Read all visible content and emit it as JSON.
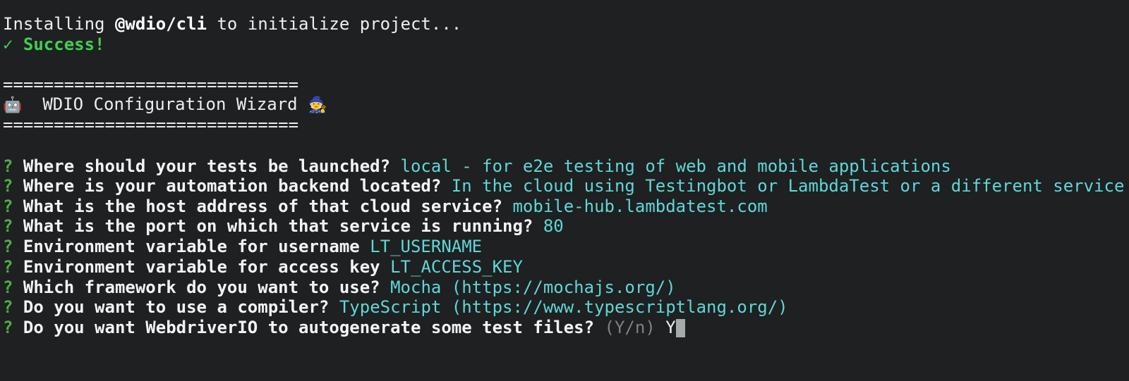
{
  "terminal": {
    "background_color": "#1e2021",
    "foreground_color": "#eceff1",
    "install": {
      "prefix": "Installing ",
      "package": "@wdio/cli",
      "suffix": " to initialize project..."
    },
    "success": {
      "check_icon": "✓",
      "label": "Success!",
      "color": "#3fcf52"
    },
    "banner": {
      "rule": "=============================",
      "robot_icon": "🤖",
      "title": "WDIO Configuration Wizard",
      "mage_icon": "🧙"
    },
    "prompt_marker": "?",
    "prompt_marker_color": "#4caf3f",
    "answer_color": "#5fd7d7",
    "dim_color": "#7d8285",
    "questions": [
      {
        "question": "Where should your tests be launched?",
        "answer": "local - for e2e testing of web and mobile applications",
        "hint": ""
      },
      {
        "question": "Where is your automation backend located?",
        "answer": "In the cloud using Testingbot or LambdaTest or a different service",
        "hint": ""
      },
      {
        "question": "What is the host address of that cloud service?",
        "answer": "mobile-hub.lambdatest.com",
        "hint": ""
      },
      {
        "question": "What is the port on which that service is running?",
        "answer": "80",
        "hint": ""
      },
      {
        "question": "Environment variable for username",
        "answer": "LT_USERNAME",
        "hint": ""
      },
      {
        "question": "Environment variable for access key",
        "answer": "LT_ACCESS_KEY",
        "hint": ""
      },
      {
        "question": "Which framework do you want to use?",
        "answer": "Mocha (https://mochajs.org/)",
        "hint": ""
      },
      {
        "question": "Do you want to use a compiler?",
        "answer": "TypeScript (https://www.typescriptlang.org/)",
        "hint": ""
      },
      {
        "question": "Do you want WebdriverIO to autogenerate some test files?",
        "answer": "Y",
        "hint": "(Y/n)"
      }
    ]
  }
}
